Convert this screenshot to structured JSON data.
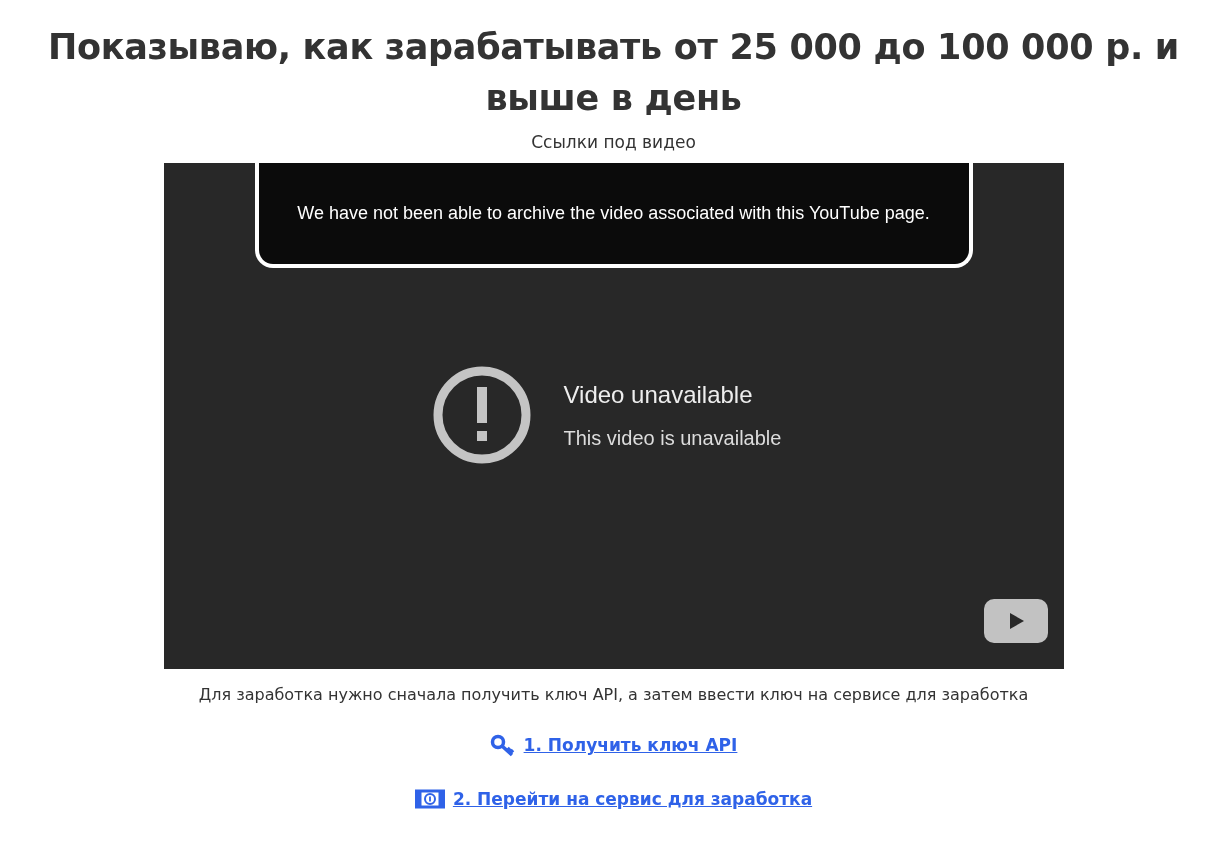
{
  "title": "Показываю, как зарабатывать от 25 000 до 100 000 р. и выше в день",
  "subtitle": "Ссылки под видео",
  "video": {
    "notice": "We have not been able to archive the video associated with this YouTube page.",
    "error_title": "Video unavailable",
    "error_message": "This video is unavailable"
  },
  "description": "Для заработка нужно сначала получить ключ API, а затем ввести ключ на сервисе для заработка",
  "links": [
    {
      "kind": "key",
      "label": "1. Получить ключ API"
    },
    {
      "kind": "money",
      "label": "2. Перейти на сервис для заработка"
    }
  ]
}
